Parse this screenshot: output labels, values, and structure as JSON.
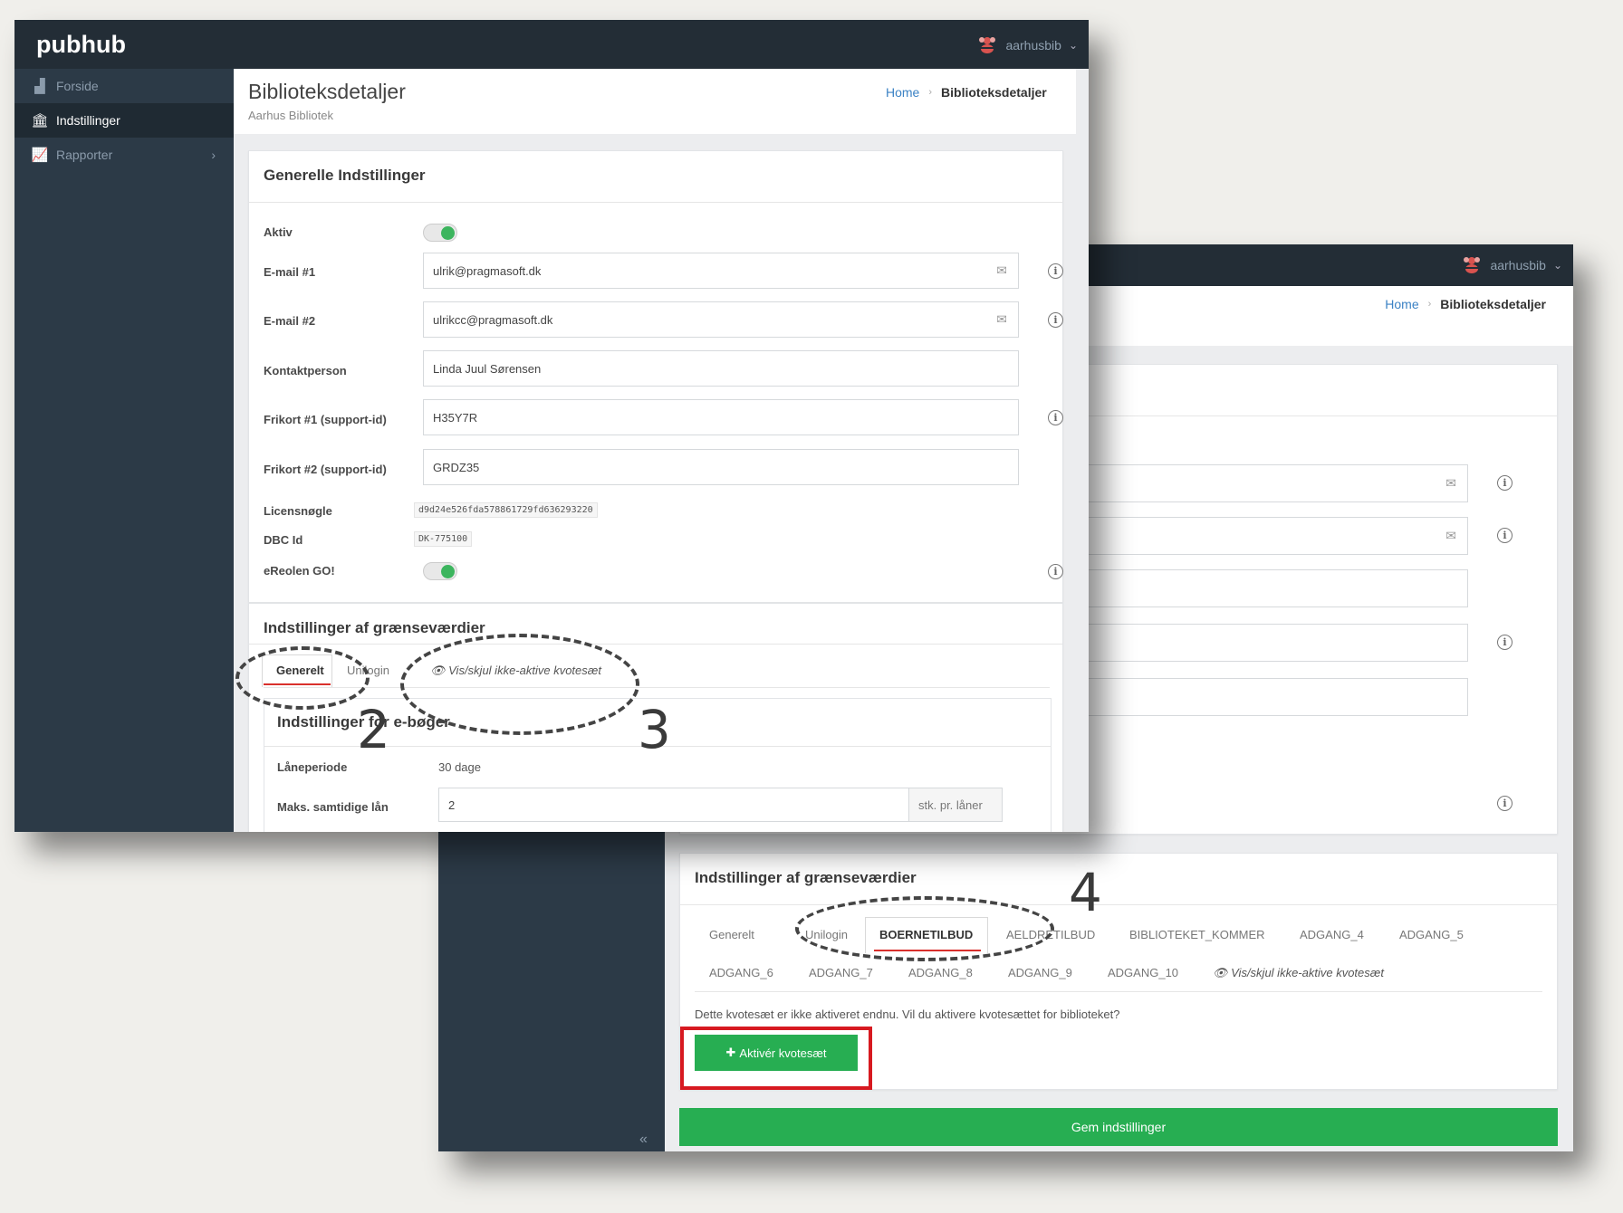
{
  "app": {
    "logo": "pubhub",
    "user": "aarhusbib"
  },
  "sidebar": {
    "items": [
      {
        "label": "Forside",
        "icon": "bar-chart-icon"
      },
      {
        "label": "Indstillinger",
        "icon": "bank-icon"
      },
      {
        "label": "Rapporter",
        "icon": "line-chart-icon"
      }
    ]
  },
  "page": {
    "title": "Biblioteksdetaljer",
    "subtitle": "Aarhus Bibliotek",
    "breadcrumb": {
      "home": "Home",
      "current": "Biblioteksdetaljer"
    }
  },
  "general": {
    "title": "Generelle Indstillinger",
    "aktiv_label": "Aktiv",
    "email1_label": "E-mail #1",
    "email1_value": "ulrik@pragmasoft.dk",
    "email2_label": "E-mail #2",
    "email2_value": "ulrikcc@pragmasoft.dk",
    "kontakt_label": "Kontaktperson",
    "kontakt_value": "Linda Juul Sørensen",
    "frikort1_label": "Frikort #1 (support-id)",
    "frikort1_value": "H35Y7R",
    "frikort2_label": "Frikort #2 (support-id)",
    "frikort2_value": "GRDZ35",
    "license_label": "Licensnøgle",
    "license_value": "d9d24e526fda578861729fd636293220",
    "dbc_label": "DBC Id",
    "dbc_value": "DK-775100",
    "ereolen_label": "eReolen GO!"
  },
  "limits": {
    "title": "Indstillinger af grænseværdier",
    "tab_generelt": "Generelt",
    "tab_unilogin": "Unilogin",
    "toggle_label": "Vis/skjul ikke-aktive kvotesæt",
    "ebooks_title": "Indstillinger for e-bøger",
    "loan_period_label": "Låneperiode",
    "loan_period_value": "30 dage",
    "max_loans_label": "Maks. samtidige lån",
    "max_loans_value": "2",
    "max_loans_unit": "stk. pr. låner"
  },
  "limits2": {
    "title": "Indstillinger af grænseværdier",
    "tabs_row1": [
      "Generelt",
      "Unilogin",
      "BOERNETILBUD",
      "AELDRETILBUD",
      "BIBLIOTEKET_KOMMER",
      "ADGANG_4",
      "ADGANG_5"
    ],
    "tabs_row2": [
      "ADGANG_6",
      "ADGANG_7",
      "ADGANG_8",
      "ADGANG_9",
      "ADGANG_10"
    ],
    "toggle_label": "Vis/skjul ikke-aktive kvotesæt",
    "message": "Dette kvotesæt er ikke aktiveret endnu. Vil du aktivere kvotesættet for biblioteket?",
    "activate_button": "Aktivér kvotesæt",
    "save_button": "Gem indstillinger"
  },
  "annotations": [
    "2",
    "3",
    "4"
  ],
  "colors": {
    "topbar": "#232d36",
    "sidebar": "#2c3a47",
    "green": "#27ae52",
    "accent_red": "#d71920",
    "link": "#3b82c4"
  }
}
